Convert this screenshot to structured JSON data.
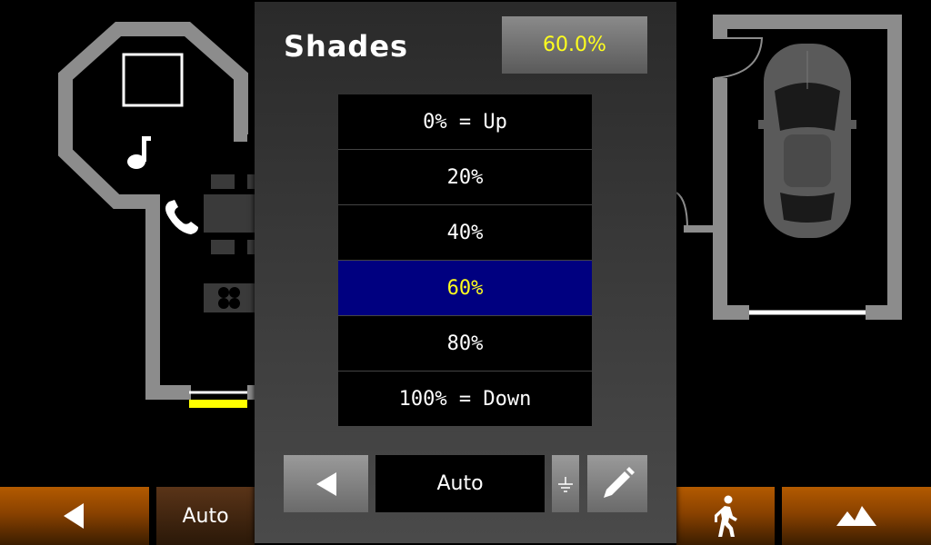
{
  "popup": {
    "title": "Shades",
    "current_value": "60.0%",
    "options": [
      {
        "label": "0% = Up",
        "selected": false
      },
      {
        "label": "20%",
        "selected": false
      },
      {
        "label": "40%",
        "selected": false
      },
      {
        "label": "60%",
        "selected": true
      },
      {
        "label": "80%",
        "selected": false
      },
      {
        "label": "100% = Down",
        "selected": false
      }
    ],
    "mode": "Auto"
  },
  "bottom_bar": {
    "auto_label": "Auto"
  },
  "colors": {
    "accent_yellow": "#ffff1e",
    "selected_bg": "#000080",
    "wall": "#8c8c8c",
    "bar_orange": "#b35a00"
  },
  "icons": [
    "music-note-icon",
    "phone-icon",
    "fan-icon",
    "car-icon",
    "back-arrow-icon",
    "walking-person-icon",
    "mountain-icon",
    "ground-icon",
    "pencil-icon"
  ]
}
